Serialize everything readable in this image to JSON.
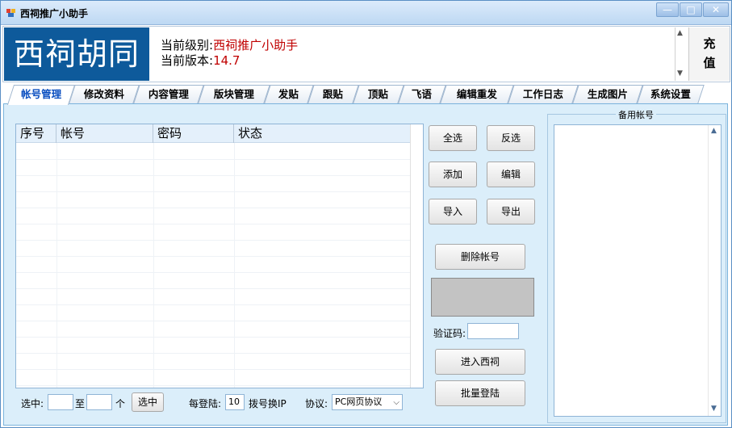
{
  "window": {
    "title": "西祠推广小助手"
  },
  "banner": {
    "logo_text": "西祠胡同",
    "level_label": "当前级别:",
    "level_value": "西祠推广小助手",
    "version_label": "当前版本:",
    "version_value": "14.7",
    "recharge_line1": "充",
    "recharge_line2": "值"
  },
  "tabs": [
    {
      "label": "帐号管理"
    },
    {
      "label": "修改资料"
    },
    {
      "label": "内容管理"
    },
    {
      "label": "版块管理"
    },
    {
      "label": "发贴"
    },
    {
      "label": "跟贴"
    },
    {
      "label": "顶贴"
    },
    {
      "label": "飞语"
    },
    {
      "label": "编辑重发"
    },
    {
      "label": "工作日志"
    },
    {
      "label": "生成图片"
    },
    {
      "label": "系统设置"
    }
  ],
  "table": {
    "columns": [
      "序号",
      "帐号",
      "密码",
      "状态"
    ]
  },
  "buttons": {
    "select_all": "全选",
    "invert": "反选",
    "add": "添加",
    "edit": "编辑",
    "import": "导入",
    "export": "导出",
    "delete_account": "删除帐号",
    "enter_xici": "进入西祠",
    "batch_login": "批量登陆",
    "select": "选中"
  },
  "captcha": {
    "label": "验证码:",
    "value": ""
  },
  "bottom": {
    "select_label": "选中:",
    "from_value": "",
    "to_label": "至",
    "to_value": "",
    "unit_label": "个",
    "per_login_label": "每登陆:",
    "per_login_value": "10",
    "dial_label": "拨号换IP",
    "protocol_label": "协议:",
    "protocol_value": "PC网页协议"
  },
  "backup": {
    "title": "备用帐号"
  }
}
